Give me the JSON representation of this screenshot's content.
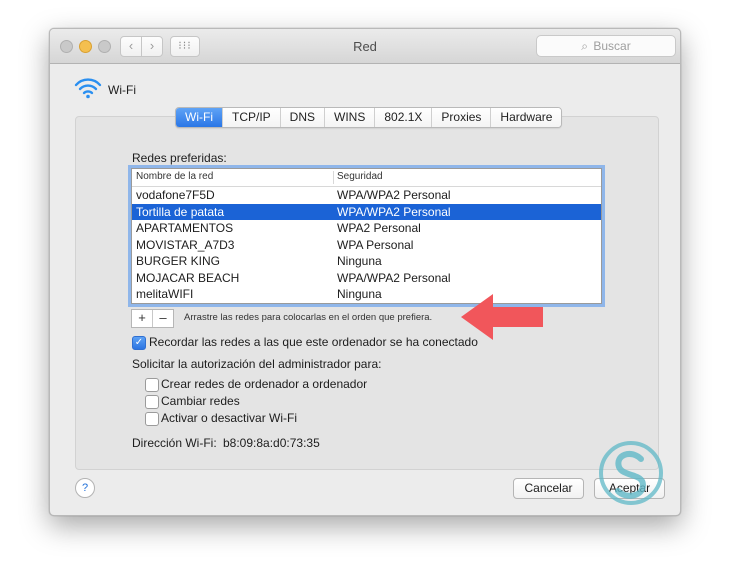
{
  "window": {
    "title": "Red",
    "search_placeholder": "Buscar"
  },
  "nav": {
    "back": "‹",
    "forward": "›",
    "grid": "⁝⁝⁝"
  },
  "header": {
    "label": "Wi-Fi"
  },
  "tabs": [
    "Wi-Fi",
    "TCP/IP",
    "DNS",
    "WINS",
    "802.1X",
    "Proxies",
    "Hardware"
  ],
  "networks": {
    "title": "Redes preferidas:",
    "col_name": "Nombre de la red",
    "col_security": "Seguridad",
    "rows": [
      {
        "name": "vodafone7F5D",
        "security": "WPA/WPA2 Personal"
      },
      {
        "name": "Tortilla de patata",
        "security": "WPA/WPA2 Personal",
        "selected": true
      },
      {
        "name": "APARTAMENTOS",
        "security": "WPA2 Personal"
      },
      {
        "name": "MOVISTAR_A7D3",
        "security": "WPA Personal"
      },
      {
        "name": "BURGER KING",
        "security": "Ninguna"
      },
      {
        "name": "MOJACAR BEACH",
        "security": "WPA/WPA2 Personal"
      },
      {
        "name": "melitaWIFI",
        "security": "Ninguna"
      }
    ],
    "add": "+",
    "remove": "–",
    "drag_hint": "Arrastre las redes para colocarlas en el orden que prefiera."
  },
  "remember": {
    "label": "Recordar las redes a las que este ordenador se ha conectado",
    "checked": true,
    "check_glyph": "✓"
  },
  "admin": {
    "title": "Solicitar la autorización del administrador para:",
    "options": [
      {
        "label": "Crear redes de ordenador a ordenador",
        "checked": false
      },
      {
        "label": "Cambiar redes",
        "checked": false
      },
      {
        "label": "Activar o desactivar Wi-Fi",
        "checked": false
      }
    ]
  },
  "address": {
    "label": "Dirección Wi-Fi:",
    "value": "b8:09:8a:d0:73:35"
  },
  "buttons": {
    "help": "?",
    "cancel": "Cancelar",
    "accept": "Aceptar"
  },
  "colors": {
    "accent": "#2a76e6",
    "selection": "#1b63d6",
    "arrow": "#f1565b",
    "logo": "#5fb8c7"
  }
}
